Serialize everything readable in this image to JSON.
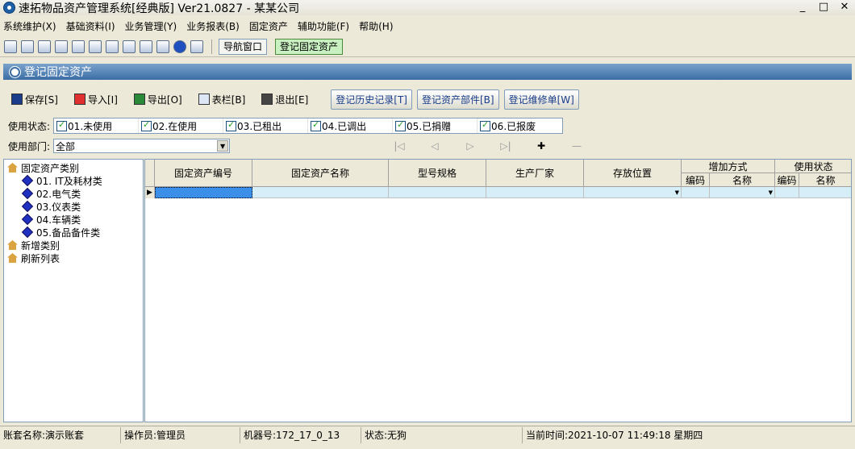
{
  "window": {
    "title": "速拓物品资产管理系统[经典版] Ver21.0827 - 某某公司",
    "min": "_",
    "max": "□",
    "close": "✕"
  },
  "menu": [
    "系统维护(X)",
    "基础资料(I)",
    "业务管理(Y)",
    "业务报表(B)",
    "固定资产",
    "辅助功能(F)",
    "帮助(H)"
  ],
  "toolbar": {
    "icons": [
      "list-icon",
      "form-icon",
      "window-icon",
      "settings-icon",
      "users-icon",
      "chart-icon",
      "tools-icon",
      "display-icon",
      "save-icon",
      "print-icon",
      "help-icon",
      "exit-icon"
    ],
    "tab_nav": "导航窗口",
    "tab_register": "登记固定资产"
  },
  "panel": {
    "title": "登记固定资产"
  },
  "actions": {
    "save": "保存[S]",
    "import": "导入[I]",
    "export": "导出[O]",
    "columns": "表栏[B]",
    "exit": "退出[E]",
    "history": "登记历史记录[T]",
    "parts": "登记资产部件[B]",
    "repair": "登记维修单[W]"
  },
  "filters": {
    "status_label": "使用状态:",
    "statuses": [
      "01.未使用",
      "02.在使用",
      "03.已租出",
      "04.已调出",
      "05.已捐赠",
      "06.已报废"
    ],
    "dept_label": "使用部门:",
    "dept_value": "全部"
  },
  "tree": {
    "root": "固定资产类别",
    "items": [
      "01. IT及耗材类",
      "02.电气类",
      "03.仪表类",
      "04.车辆类",
      "05.备品备件类"
    ],
    "add": "新增类别",
    "refresh": "刷新列表"
  },
  "grid": {
    "headers": {
      "code": "固定资产编号",
      "name": "固定资产名称",
      "model": "型号规格",
      "maker": "生产厂家",
      "location": "存放位置",
      "add_method": "增加方式",
      "status": "使用状态",
      "sub_code": "编码",
      "sub_name": "名称"
    }
  },
  "statusbar": {
    "account": "账套名称:演示账套",
    "operator": "操作员:管理员",
    "machine": "机器号:172_17_0_13",
    "state": "状态:无狗",
    "time": "当前时间:2021-10-07 11:49:18 星期四"
  }
}
